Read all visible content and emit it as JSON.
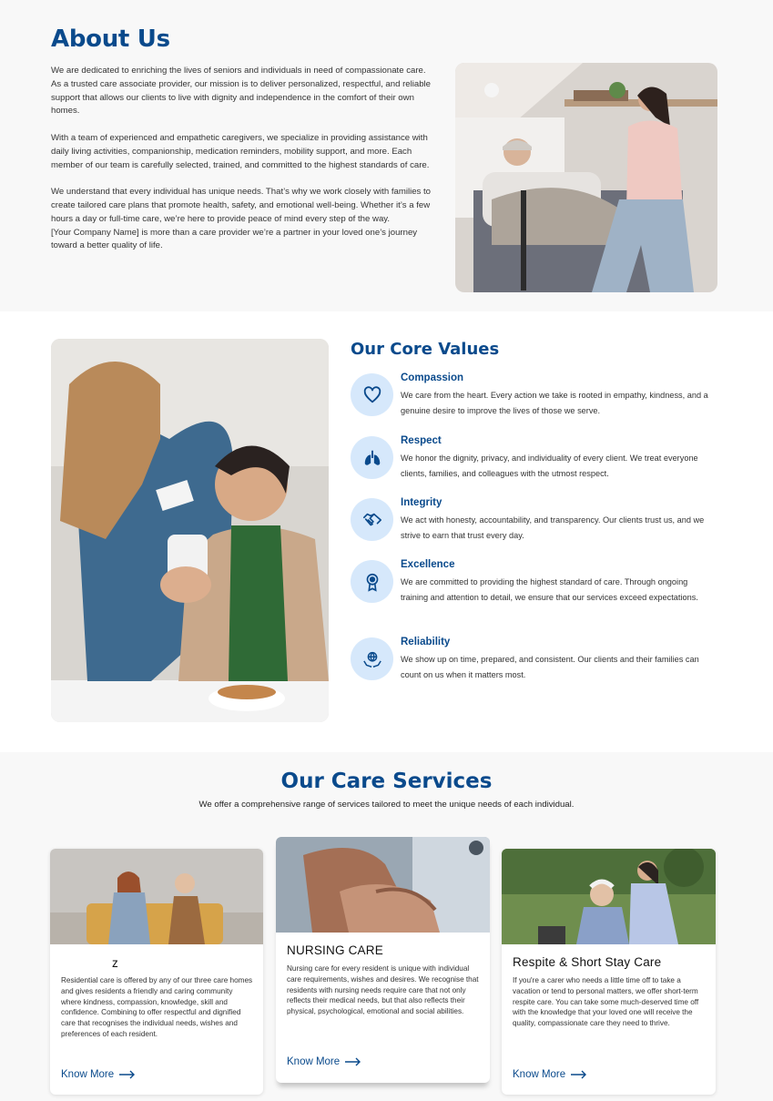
{
  "about": {
    "title": "About Us",
    "p1": "We are dedicated to enriching the lives of seniors and individuals in need of compassionate care. As a trusted care associate provider, our mission is to deliver personalized, respectful, and reliable support that allows our clients to live with dignity and independence in the comfort of their own homes.",
    "p2": "With a team of experienced and empathetic caregivers, we specialize in providing assistance with daily living activities, companionship, medication reminders, mobility support, and more. Each member of our team is carefully selected, trained, and committed to the highest standards of care.",
    "p3": "We understand that every individual has unique needs. That’s why we work closely with families to create tailored care plans that promote health, safety, and emotional well-being. Whether it’s a few hours a day or full-time care, we’re here to provide peace of mind every step of the way.",
    "p4": "[Your Company Name] is more than a care provider we’re a partner in your loved one’s journey toward a better quality of life."
  },
  "values": {
    "title": "Our Core Values",
    "items": [
      {
        "title": "Compassion",
        "icon": "heart-icon",
        "desc": "We care from the heart. Every action we take is rooted in empathy, kindness, and a genuine desire to improve the lives of those we serve."
      },
      {
        "title": "Respect",
        "icon": "lungs-icon",
        "desc": "We honor the dignity, privacy, and individuality of every client. We treat everyone clients, families, and colleagues  with the utmost respect."
      },
      {
        "title": "Integrity",
        "icon": "handshake-icon",
        "desc": "We act with honesty, accountability, and transparency. Our clients trust us, and we strive to earn that trust every day."
      },
      {
        "title": "Excellence",
        "icon": "award-icon",
        "desc": "We are committed to providing the highest standard of care. Through ongoing training and attention to detail, we ensure that our services exceed expectations."
      },
      {
        "title": "Reliability",
        "icon": "globe-hands-icon",
        "desc": "We show up on time, prepared, and consistent. Our clients and their families can count on us when it matters most."
      }
    ]
  },
  "services": {
    "title": "Our Care Services",
    "subtitle": "We offer a comprehensive range of services tailored to meet the unique needs of each individual.",
    "cards": [
      {
        "title": "z",
        "desc": "Residential care is offered by any of our three care homes and gives residents a friendly and caring community where kindness, compassion, knowledge, skill and confidence. Combining to offer respectful and dignified care that recognises the individual needs, wishes and preferences of each resident.",
        "link": "Know More"
      },
      {
        "title": "NURSING CARE",
        "desc": "Nursing care for every resident is unique with individual care requirements, wishes and desires. We recognise that residents with nursing needs require care that not only reflects their medical needs, but that also reflects their physical, psychological, emotional and social abilities.",
        "link": "Know More"
      },
      {
        "title": "Respite & Short Stay Care",
        "desc": "If you're a carer who needs a little time off to take a vacation or tend to personal matters, we offer short-term respite care. You can take some much-deserved time off with the knowledge that your loved one will receive the quality, compassionate care they need to thrive.",
        "link": "Know More"
      }
    ]
  },
  "colors": {
    "brand": "#0a4a8c",
    "icon_bg": "#d6e8fb"
  }
}
